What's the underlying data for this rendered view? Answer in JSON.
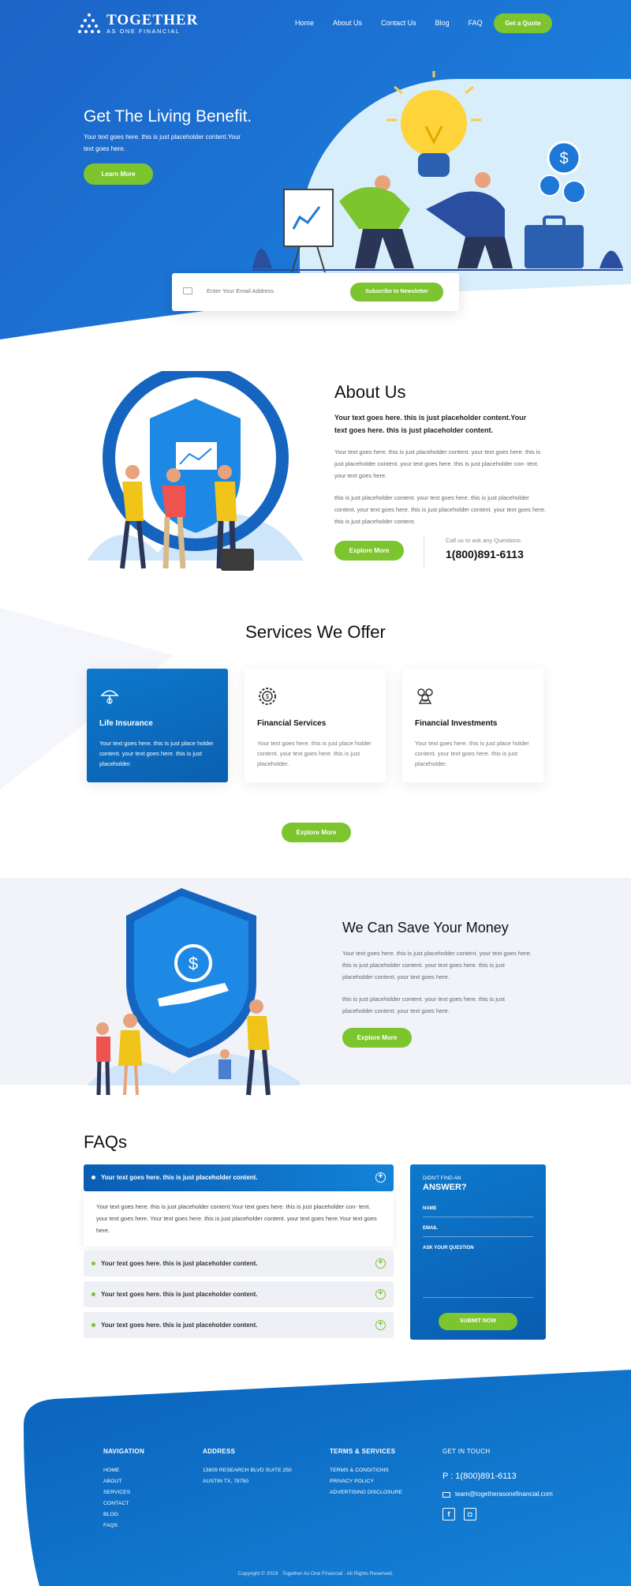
{
  "brand": {
    "name": "TOGETHER",
    "sub": "AS ONE FINANCIAL"
  },
  "nav": {
    "items": [
      "Home",
      "About Us",
      "Contact Us",
      "Blog",
      "FAQ"
    ],
    "quote": "Get a Quote"
  },
  "hero": {
    "title": "Get The Living Benefit.",
    "text": "Your text goes here. this is just placeholder content.Your text goes here.",
    "cta": "Learn More"
  },
  "subscribe": {
    "placeholder": "Enter Your Email Address",
    "button": "Subscribe to Newsletter"
  },
  "about": {
    "title": "About Us",
    "lead": "Your text goes here. this is just placeholder content.Your text goes here. this is just placeholder content.",
    "p1": "Your text goes here. this is just placeholder content. your text goes here. this is just placeholder content. your text goes here. this is just placeholder con- tent. your text goes here.",
    "p2": "this is just placeholder content. your text goes here. this is just placeholder content. your text goes here. this is just placeholder content. your text goes here. this is just placeholder content.",
    "cta": "Explore More",
    "call_label": "Call us to ask any Questions",
    "phone": "1(800)891-6113"
  },
  "services": {
    "title": "Services We Offer",
    "cards": [
      {
        "title": "Life Insurance",
        "text": "Your text goes here. this is just place holder content. your text goes here. this is just placeholder."
      },
      {
        "title": "Financial Services",
        "text": "Your text goes here. this is just place holder content. your text goes here. this is just placeholder."
      },
      {
        "title": "Financial Investments",
        "text": "Your text goes here. this is just place holder content. your text goes here. this is just placeholder."
      }
    ],
    "cta": "Explore More"
  },
  "save": {
    "title": "We Can Save Your Money",
    "p1": "Your text goes here. this is just placeholder content. your text goes here. this is just placeholder content. your text goes here. this is just placeholder content. your text goes here.",
    "p2": "this is just placeholder content. your text goes here. this is just placeholder content. your text goes here.",
    "cta": "Explore More"
  },
  "faq": {
    "title": "FAQs",
    "active_q": "Your text goes here. this is just placeholder content.",
    "active_a": "Your text goes here. this is just placeholder content.Your text goes here. this is just placeholder con- tent. your text goes here. Your text goes here. this is just placeholder content. your text goes here.Your text goes here.",
    "items": [
      "Your text goes here. this is just placeholder content.",
      "Your text goes here. this is just placeholder content.",
      "Your text goes here. this is just placeholder content."
    ]
  },
  "ask": {
    "small": "DIDN'T FIND AN",
    "big": "ANSWER?",
    "name": "NAME",
    "email": "EMAIL",
    "question": "ASK YOUR QUESTION",
    "submit": "SUBMIT NOW"
  },
  "footer": {
    "nav_h": "NAVIGATION",
    "nav": [
      "HOME",
      "ABOUT",
      "SERVICES",
      "CONTACT",
      "BLOG",
      "FAQS"
    ],
    "addr_h": "ADDRESS",
    "addr": [
      "13809 RESEARCH BLVD SUITE 250",
      "AUSTIN TX, 78750"
    ],
    "terms_h": "TERMS & SERVICES",
    "terms": [
      "TERMS & CONDITIONS",
      "PRIVACY POLICY",
      "ADVERTISING DISCLOSURE"
    ],
    "touch_h": "GET IN TOUCH",
    "phone": "P : 1(800)891-6113",
    "email": "team@togetherasonefinancial.com",
    "copyright": "Copyright © 2019 · Together As One Financial · All Rights Reserved."
  },
  "colors": {
    "primary": "#1a6fd0",
    "accent": "#7cc52e"
  }
}
